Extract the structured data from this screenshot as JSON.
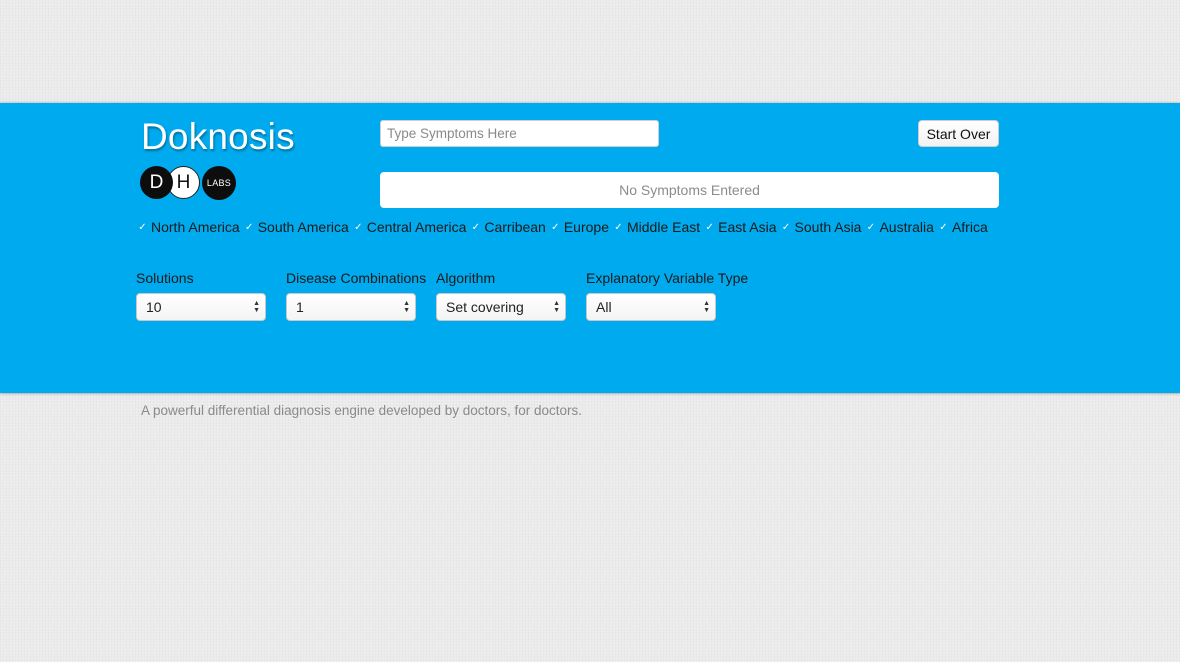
{
  "app": {
    "title": "Doknosis",
    "logo": {
      "d": "D",
      "h": "H",
      "labs": "LABS"
    }
  },
  "search": {
    "placeholder": "Type Symptoms Here",
    "value": ""
  },
  "start_over_label": "Start Over",
  "symptoms_status": "No Symptoms Entered",
  "regions": [
    {
      "label": "North America",
      "checked": true
    },
    {
      "label": "South America",
      "checked": true
    },
    {
      "label": "Central America",
      "checked": true
    },
    {
      "label": "Carribean",
      "checked": true
    },
    {
      "label": "Europe",
      "checked": true
    },
    {
      "label": "Middle East",
      "checked": true
    },
    {
      "label": "East Asia",
      "checked": true
    },
    {
      "label": "South Asia",
      "checked": true
    },
    {
      "label": "Australia",
      "checked": true
    },
    {
      "label": "Africa",
      "checked": true
    }
  ],
  "controls": {
    "solutions": {
      "label": "Solutions",
      "value": "10"
    },
    "combinations": {
      "label": "Disease Combinations",
      "value": "1"
    },
    "algorithm": {
      "label": "Algorithm",
      "value": "Set covering"
    },
    "variable_type": {
      "label": "Explanatory Variable Type",
      "value": "All"
    }
  },
  "tagline": "A powerful differential diagnosis engine developed by doctors, for doctors.",
  "colors": {
    "banner": "#00aaee",
    "page_bg": "#ebebeb"
  }
}
